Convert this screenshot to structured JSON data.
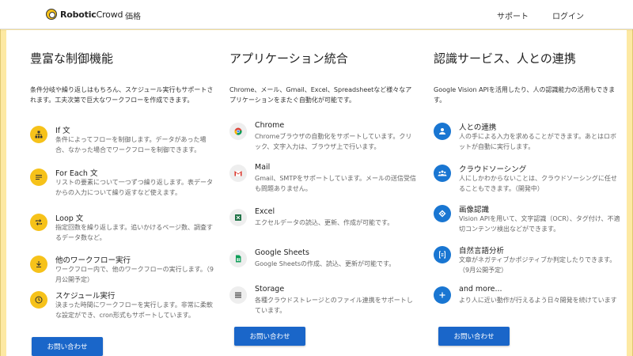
{
  "header": {
    "logo_bold": "Robotic",
    "logo_light": "Crowd",
    "nav_pricing": "価格",
    "nav_support": "サポート",
    "nav_login": "ログイン"
  },
  "cta_label": "お問い合わせ",
  "columns": [
    {
      "title": "豊富な制御機能",
      "desc": "条件分岐や繰り返しはもちろん、スケジュール実行もサポートされます。工夫次第で巨大なワークフローを作成できます。",
      "items": [
        {
          "title": "If 文",
          "desc": "条件によってフローを制御します。データがあった場合、なかった場合でワークフローを制御できます。",
          "icon": "sitemap-icon"
        },
        {
          "title": "For Each 文",
          "desc": "リストの要素について一つずつ繰り返します。表データからの入力について繰り返すなど使えます。",
          "icon": "list-icon"
        },
        {
          "title": "Loop 文",
          "desc": "指定回数を繰り返します。追いかけるページ数、調査するデータ数など。",
          "icon": "repeat-icon"
        },
        {
          "title": "他のワークフロー実行",
          "desc": "ワークフロー内で、他のワークフローの実行します。（9月公開予定）",
          "icon": "download-icon"
        },
        {
          "title": "スケジュール実行",
          "desc": "決まった時間にワークフローを実行します。非常に柔軟な設定ができ、cron形式もサポートしています。",
          "icon": "clock-icon"
        }
      ]
    },
    {
      "title": "アプリケーション統合",
      "desc": "Chrome、メール、Gmail、Excel、Spreadsheetなど様々なアプリケーションをまたぐ自動化が可能です。",
      "items": [
        {
          "title": "Chrome",
          "desc": "Chromeブラウザの自動化をサポートしています。クリック、文字入力は、ブラウザ上で行います。",
          "icon": "chrome-icon"
        },
        {
          "title": "Mail",
          "desc": "Gmail、SMTPをサポートしています。メールの送信受信も問題ありません。",
          "icon": "gmail-icon"
        },
        {
          "title": "Excel",
          "desc": "エクセルデータの読込、更新、作成が可能です。",
          "icon": "excel-icon"
        },
        {
          "title": "Google Sheets",
          "desc": "Google Sheetsの作成、読込、更新が可能です。",
          "icon": "sheets-icon"
        },
        {
          "title": "Storage",
          "desc": "各種クラウドストレージとのファイル連携をサポートしています。",
          "icon": "storage-icon"
        }
      ]
    },
    {
      "title": "認識サービス、人との連携",
      "desc": "Google Vision APIを活用したり、人の認識能力の活用もできます。",
      "items": [
        {
          "title": "人との連携",
          "desc": "人の手による入力を求めることができます。あとはロボットが自動に実行します。",
          "icon": "person-icon"
        },
        {
          "title": "クラウドソーシング",
          "desc": "人にしかわからないことは、クラウドソーシングに任せることもできます。（開発中）",
          "icon": "group-icon"
        },
        {
          "title": "画像認識",
          "desc": "Vision APIを用いて、文字認識（OCR）、タグ付け、不適切コンテンツ検出などができます。",
          "icon": "vision-icon"
        },
        {
          "title": "自然言語分析",
          "desc": "文章がネガティブかポジティブか判定したりできます。（9月公開予定）",
          "icon": "language-icon"
        },
        {
          "title": "and more...",
          "desc": "より人に近い動作が行えるよう日々開発を続けています",
          "icon": "plus-icon"
        }
      ]
    }
  ]
}
